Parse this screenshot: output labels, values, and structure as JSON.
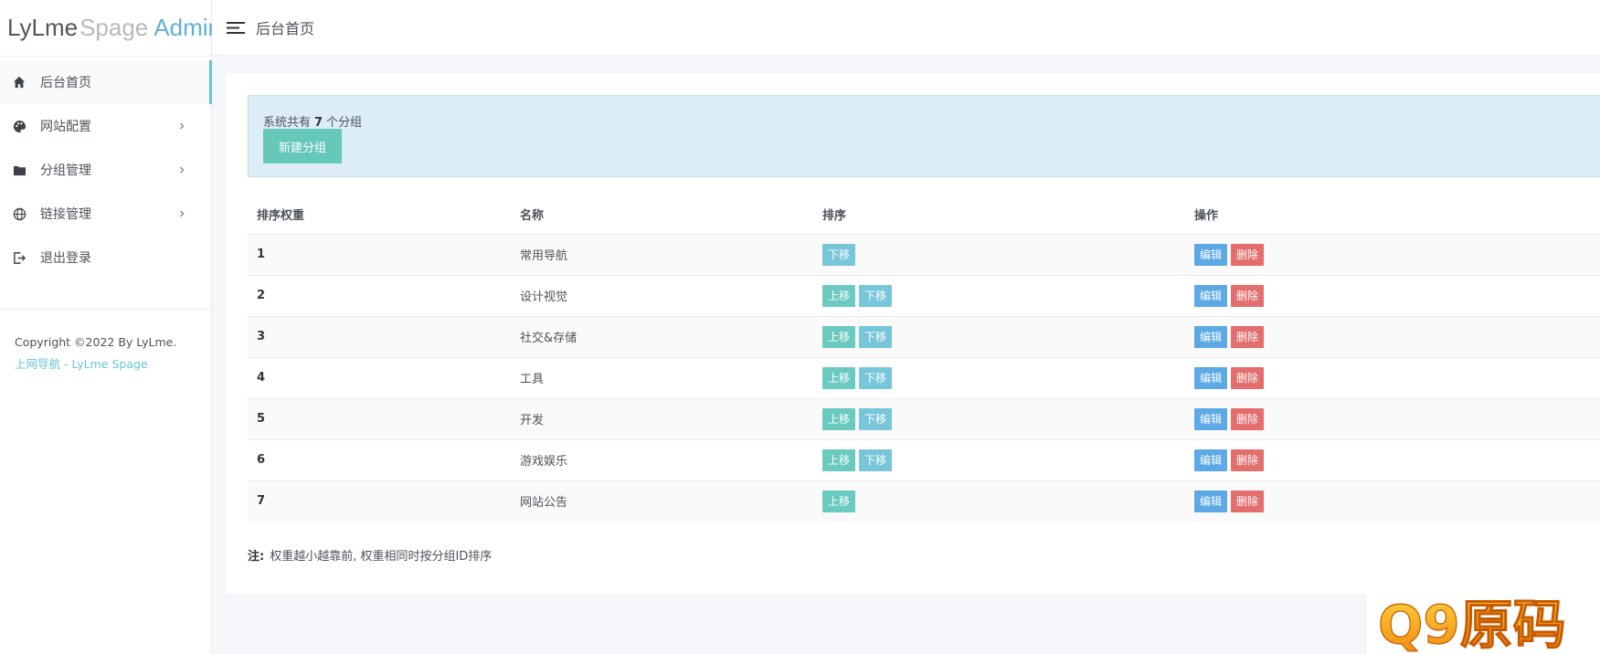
{
  "logo": {
    "part1": "LyLme",
    "part2": "Spage",
    "part3": "Admin"
  },
  "sidebar": {
    "items": [
      {
        "label": "后台首页",
        "icon": "home-icon"
      },
      {
        "label": "网站配置",
        "icon": "palette-icon"
      },
      {
        "label": "分组管理",
        "icon": "folder-icon"
      },
      {
        "label": "链接管理",
        "icon": "globe-icon"
      },
      {
        "label": "退出登录",
        "icon": "logout-icon"
      }
    ]
  },
  "copyright": {
    "text": "Copyright ©2022 By LyLme.",
    "link": "上网导航 - LyLme Spage"
  },
  "topbar": {
    "title": "后台首页"
  },
  "alert": {
    "prefix": "系统共有",
    "count": "7",
    "suffix": "个分组",
    "button": "新建分组"
  },
  "table": {
    "headers": [
      "排序权重",
      "名称",
      "排序",
      "操作"
    ],
    "rows": [
      {
        "weight": "1",
        "name": "常用导航"
      },
      {
        "weight": "2",
        "name": "设计视觉"
      },
      {
        "weight": "3",
        "name": "社交&存储"
      },
      {
        "weight": "4",
        "name": "工具"
      },
      {
        "weight": "5",
        "name": "开发"
      },
      {
        "weight": "6",
        "name": "游戏娱乐"
      },
      {
        "weight": "7",
        "name": "网站公告"
      }
    ],
    "btn_up": "上移",
    "btn_down": "下移",
    "btn_edit": "编辑",
    "btn_del": "删除"
  },
  "note": {
    "label": "注:",
    "text": "权重越小越靠前, 权重相同时按分组ID排序"
  },
  "watermark": {
    "text": "Q9原码"
  },
  "colors": {
    "accent": "#67c5d4",
    "up": "#6acac0",
    "down": "#78c6da",
    "edit": "#5ca9e6",
    "del": "#e46d6d"
  }
}
